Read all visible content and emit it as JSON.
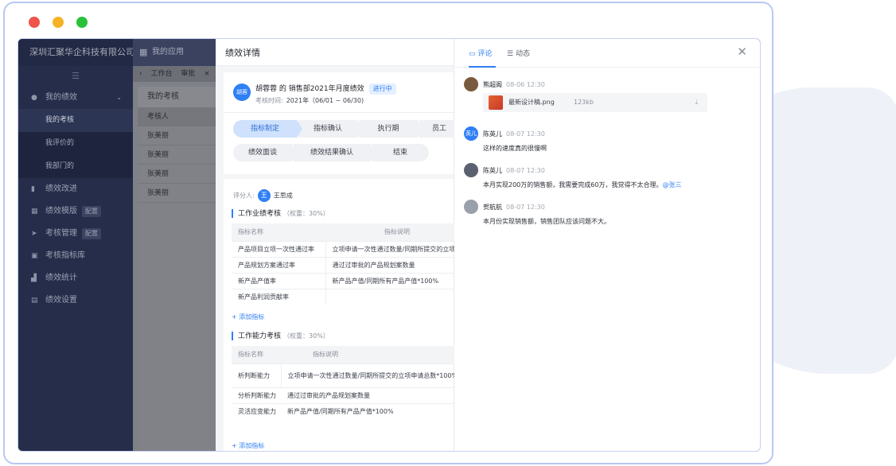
{
  "window": {
    "buttons": [
      "close",
      "minimize",
      "maximize"
    ]
  },
  "app": {
    "company": "深圳汇聚华企科技有限公司名称",
    "apps_label": "我的应用",
    "sidebar": {
      "collapse_icon": "collapse-icon",
      "groups": [
        {
          "label": "我的绩效",
          "icon": "user-icon",
          "children": [
            "我的考核",
            "我评价的",
            "我部门的"
          ],
          "active_child": "我的考核"
        },
        {
          "label": "绩效改进",
          "icon": "book-icon"
        },
        {
          "label": "绩效模版",
          "icon": "template-icon",
          "badge": "配置"
        },
        {
          "label": "考核管理",
          "icon": "send-icon",
          "badge": "配置"
        },
        {
          "label": "考核指标库",
          "icon": "library-icon"
        },
        {
          "label": "绩效统计",
          "icon": "chart-icon"
        },
        {
          "label": "绩效设置",
          "icon": "settings-icon"
        }
      ]
    },
    "tabs": [
      "工作台",
      "审批"
    ],
    "panel": {
      "title": "我的考核",
      "column": "考核人",
      "rows": [
        "张美丽",
        "张美丽",
        "张美丽",
        "张美丽"
      ]
    }
  },
  "detail": {
    "title": "绩效详情",
    "avatar_text": "胡蓉",
    "plan_title": "胡蓉蓉 的 销售部2021年月度绩效",
    "status": "进行中",
    "period_label": "考核时间:",
    "period_value": "2021年（06/01 ~ 06/30)",
    "steps": [
      "指标制定",
      "指标确认",
      "执行期",
      "员工",
      "绩效面谈",
      "绩效结果确认",
      "结束"
    ],
    "current_step": "指标制定",
    "reviewer_label": "评分人:",
    "reviewer_avatar": "王",
    "reviewer_name": "王思成",
    "sections": [
      {
        "title": "工作业绩考核",
        "weight": "（权重：30%）",
        "headers": [
          "指标名称",
          "指标说明"
        ],
        "rows": [
          [
            "产品项目立项一次性通过率",
            "立项申请一次性通过数量/同期所提交的立项"
          ],
          [
            "产品规划方案通过率",
            "通过过审批的产品规划案数量"
          ],
          [
            "新产品产值率",
            "新产品产值/同期所有产品产值*100%"
          ],
          [
            "新产品利润贡献率",
            ""
          ]
        ],
        "add_label": "+ 添加指标"
      },
      {
        "title": "工作能力考核",
        "weight": "（权重：30%）",
        "headers": [
          "指标名称",
          "指标说明"
        ],
        "rows": [
          [
            "析判断能力",
            "立项申请一次性通过数量/同期所提交的立项申请总数*100%"
          ],
          [
            "分析判断能力",
            "通过过审批的产品规划案数量"
          ],
          [
            "灵活应变能力",
            "新产品产值/同期所有产品产值*100%"
          ]
        ],
        "add_label": "+ 添加指标"
      }
    ]
  },
  "comments": {
    "tabs": [
      {
        "label": "评论",
        "icon": "comment-icon"
      },
      {
        "label": "动态",
        "icon": "list-icon"
      }
    ],
    "active_tab": "评论",
    "close_icon": "close-icon",
    "items": [
      {
        "name": "熊超阁",
        "time": "08-06 12:30",
        "text": "",
        "avatar": "",
        "avatar_color": "#7a5a3e",
        "attachment": {
          "name": "最新设计稿.png",
          "size": "123kb",
          "icon": "image-file-icon",
          "action_icon": "download-icon"
        }
      },
      {
        "name": "陈英儿",
        "time": "08-07 12:30",
        "text": "这样的速度真的很慢啊",
        "avatar": "英儿",
        "avatar_color": "#2f7ff5"
      },
      {
        "name": "陈英儿",
        "time": "08-07 12:30",
        "text": "本月实现200万的销售额，我需要完成60万，我觉得不太合理。",
        "mention": "@张三",
        "avatar": "",
        "avatar_color": "#5b6170"
      },
      {
        "name": "贺航航",
        "time": "08-07 12:30",
        "text": "本月份实现销售额，销售团队应该问题不大。",
        "avatar": "",
        "avatar_color": "#9aa0aa"
      }
    ]
  }
}
